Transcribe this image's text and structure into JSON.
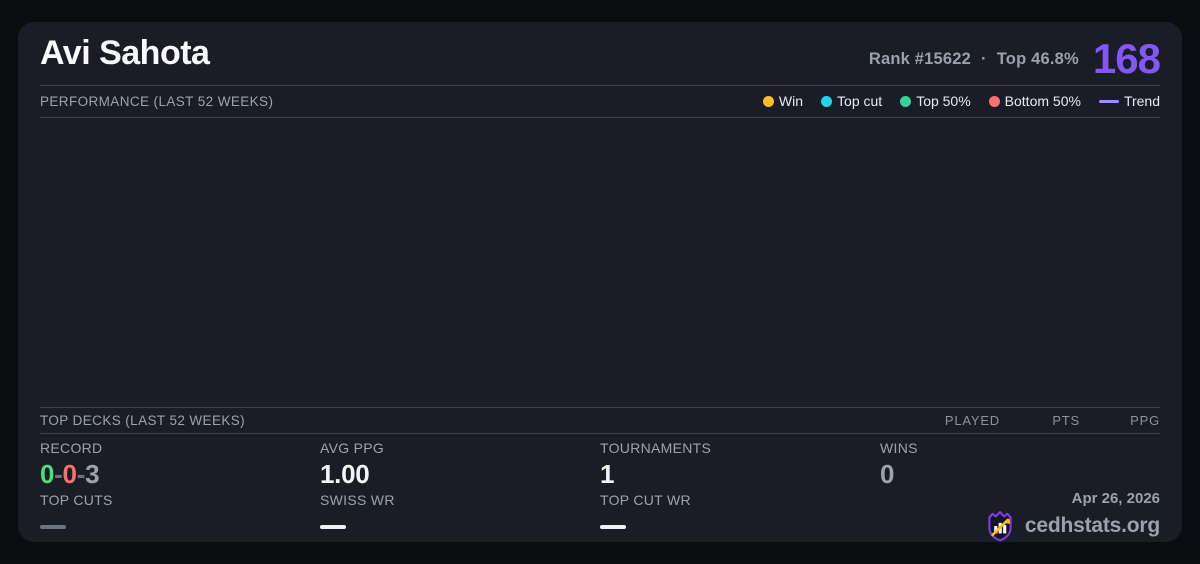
{
  "header": {
    "player_name": "Avi Sahota",
    "rank_text": "Rank #15622",
    "dot_separator": "·",
    "top_percent_text": "Top 46.8%",
    "score": "168",
    "score_color": "#8356f6"
  },
  "performance": {
    "title": "PERFORMANCE (LAST 52 WEEKS)",
    "legend": [
      {
        "label": "Win",
        "color": "#fbbf24",
        "swatch": "dot"
      },
      {
        "label": "Top cut",
        "color": "#22d3ee",
        "swatch": "dot"
      },
      {
        "label": "Top 50%",
        "color": "#34d399",
        "swatch": "dot"
      },
      {
        "label": "Bottom 50%",
        "color": "#f87171",
        "swatch": "dot"
      },
      {
        "label": "Trend",
        "color": "#a78bfa",
        "swatch": "line"
      }
    ],
    "chart_empty": true
  },
  "top_decks": {
    "title": "TOP DECKS (LAST 52 WEEKS)",
    "columns": [
      "PLAYED",
      "PTS",
      "PPG"
    ],
    "rows": []
  },
  "stats": {
    "record": {
      "label": "RECORD",
      "wins": "0",
      "sep1": "-",
      "losses": "0",
      "sep2": "-",
      "draws": "3",
      "wins_color": "#4ade80",
      "losses_color": "#f87171",
      "draws_color": "#9ca3af"
    },
    "avg_ppg": {
      "label": "AVG PPG",
      "value": "1.00"
    },
    "tournaments": {
      "label": "TOURNAMENTS",
      "value": "1"
    },
    "wins": {
      "label": "WINS",
      "value": "0"
    },
    "top_cuts": {
      "label": "TOP CUTS",
      "value": "—"
    },
    "swiss_wr": {
      "label": "SWISS WR",
      "value": "—"
    },
    "top_cut_wr": {
      "label": "TOP CUT WR",
      "value": "—"
    }
  },
  "footer": {
    "date": "Apr 26, 2026",
    "brand": "cedhstats.org"
  }
}
